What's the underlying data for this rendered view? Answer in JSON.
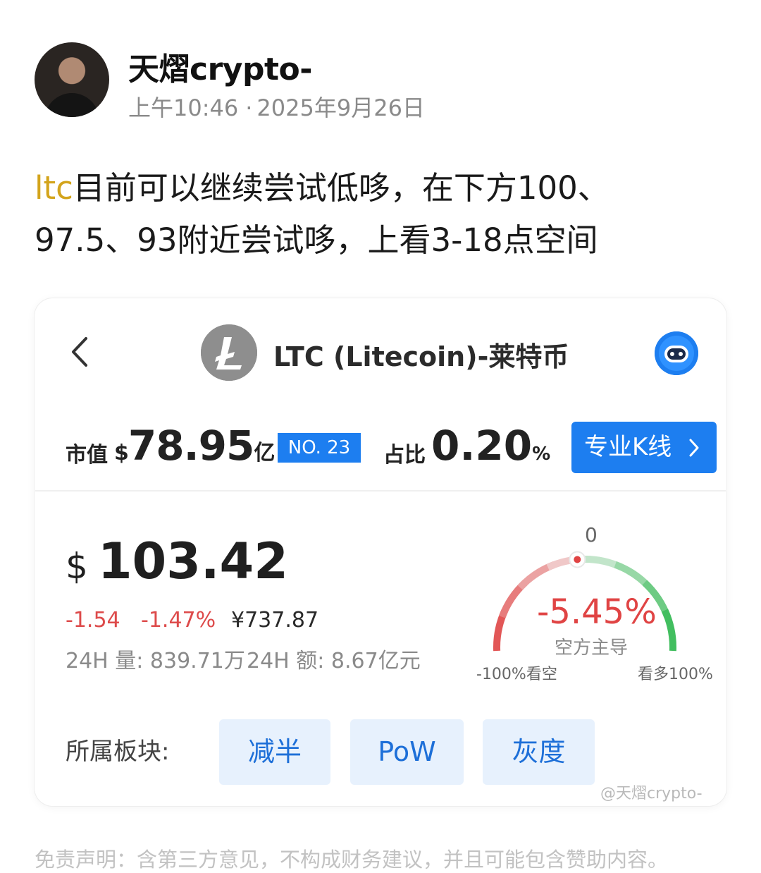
{
  "post_header": {
    "author": "天熠crypto-",
    "time": "上午10:46",
    "separator": "·",
    "date": "2025年9月26日"
  },
  "post_body": {
    "tag": "ltc",
    "line1_rest": "目前可以继续尝试低哆，在下方100、",
    "line2": "97.5、93附近尝试哆，上看3-18点空间"
  },
  "coin_card": {
    "back_icon": "chevron-left-icon",
    "logo_icon": "litecoin-logo-icon",
    "title": "LTC (Litecoin)-莱特币",
    "bot_icon": "robot-assistant-icon",
    "market_cap": {
      "label": "市值",
      "currency": "$",
      "value": "78.95",
      "unit": "亿"
    },
    "rank": "NO. 23",
    "share": {
      "label": "占比",
      "value": "0.20",
      "unit": "%"
    },
    "kline_button": "专业K线",
    "price": {
      "currency": "$",
      "value": "103.42"
    },
    "change_abs": "-1.54",
    "change_pct": "-1.47%",
    "price_cny": "¥737.87",
    "volume_24h": "24H 量: 839.71万",
    "amount_24h": "24H 额: 8.67亿元",
    "sentiment": {
      "zero_label": "0",
      "value": "-5.45%",
      "value_numeric": -5.45,
      "caption": "空方主导",
      "left_label": "-100%看空",
      "right_label": "看多100%",
      "bear_color": "#e04444",
      "bull_color": "#2db84d"
    },
    "sectors_label": "所属板块:",
    "sectors": [
      "减半",
      "PoW",
      "灰度"
    ]
  },
  "watermark": "@天熠crypto-",
  "disclaimer": "免责声明：含第三方意见，不构成财务建议，并且可能包含赞助内容。",
  "colors": {
    "accent_blue": "#1d7ef0",
    "tag_gold": "#d3a41c",
    "down_red": "#dd4a4a"
  }
}
